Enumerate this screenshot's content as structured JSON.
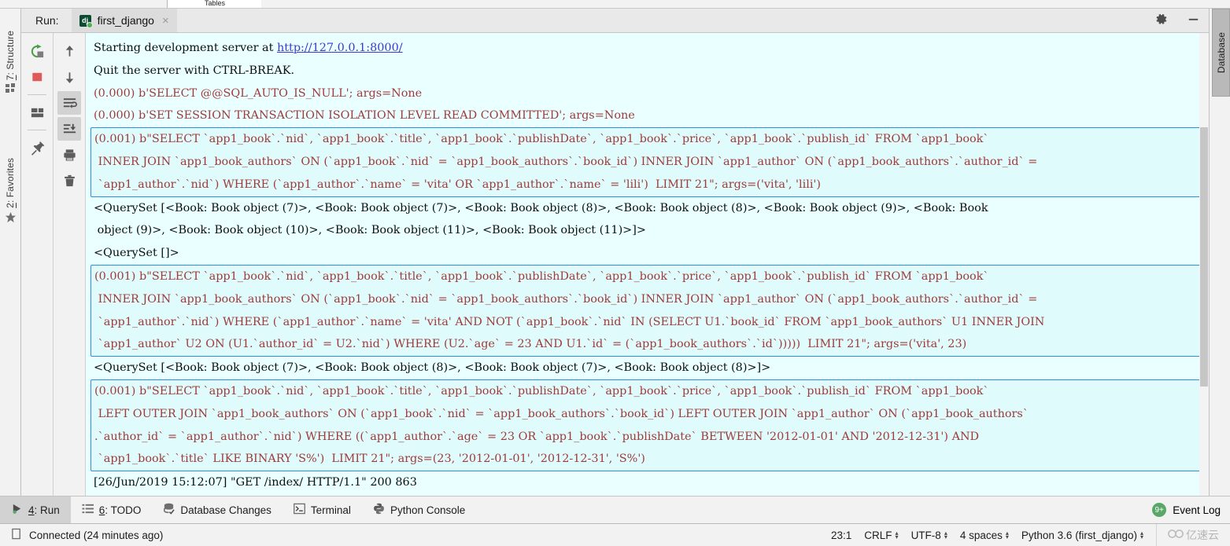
{
  "window": {
    "top_tab_stub_label": "Tables"
  },
  "run_panel": {
    "title": "Run:",
    "tab": {
      "icon": "django-icon",
      "label": "first_django",
      "close_label": "×"
    },
    "header_actions": [
      {
        "name": "settings-gear-icon",
        "label": ""
      },
      {
        "name": "minimize-icon",
        "label": ""
      }
    ],
    "toolbar_left": [
      {
        "name": "rerun-icon",
        "label": "Rerun"
      },
      {
        "name": "stop-icon",
        "label": "Stop"
      },
      {
        "name": "layout-icon",
        "label": "Layout"
      },
      {
        "name": "pin-icon",
        "label": "Pin Tab"
      }
    ],
    "toolbar_second": [
      {
        "name": "up-arrow-icon",
        "label": "Up the stack trace"
      },
      {
        "name": "down-arrow-icon",
        "label": "Down the stack trace"
      },
      {
        "name": "soft-wrap-icon",
        "label": "Use Soft Wraps"
      },
      {
        "name": "scroll-to-end-icon",
        "label": "Scroll to the end"
      },
      {
        "name": "print-icon",
        "label": "Print"
      },
      {
        "name": "trash-icon",
        "label": "Clear All"
      }
    ]
  },
  "rail_left": [
    {
      "name": "sidebar-item-structure",
      "num": "7",
      "label": ": Structure",
      "icon": "structure-icon"
    },
    {
      "name": "sidebar-item-favorites",
      "num": "2",
      "label": ": Favorites",
      "icon": "star-icon"
    }
  ],
  "rail_right": [
    {
      "name": "sidebar-item-database",
      "label": "Database",
      "icon": "database-icon"
    }
  ],
  "console": {
    "lines": [
      {
        "type": "plain",
        "segments": [
          {
            "text": "Starting development server at ",
            "style": "black"
          },
          {
            "text": "http://127.0.0.1:8000/",
            "style": "link"
          }
        ]
      },
      {
        "type": "plain",
        "segments": [
          {
            "text": "Quit the server with CTRL-BREAK.",
            "style": "black"
          }
        ]
      },
      {
        "type": "plain",
        "segments": [
          {
            "text": "(0.000) b'SELECT @@SQL_AUTO_IS_NULL'; args=None",
            "style": "sql"
          }
        ]
      },
      {
        "type": "plain",
        "segments": [
          {
            "text": "(0.000) b'SET SESSION TRANSACTION ISOLATION LEVEL READ COMMITTED'; args=None",
            "style": "sql"
          }
        ]
      },
      {
        "type": "sqlbox",
        "rows": [
          "(0.001) b\"SELECT `app1_book`.`nid`, `app1_book`.`title`, `app1_book`.`publishDate`, `app1_book`.`price`, `app1_book`.`publish_id` FROM `app1_book`",
          " INNER JOIN `app1_book_authors` ON (`app1_book`.`nid` = `app1_book_authors`.`book_id`) INNER JOIN `app1_author` ON (`app1_book_authors`.`author_id` =",
          " `app1_author`.`nid`) WHERE (`app1_author`.`name` = 'vita' OR `app1_author`.`name` = 'lili')  LIMIT 21\"; args=('vita', 'lili')"
        ]
      },
      {
        "type": "plain",
        "segments": [
          {
            "text": "<QuerySet [<Book: Book object (7)>, <Book: Book object (7)>, <Book: Book object (8)>, <Book: Book object (8)>, <Book: Book object (9)>, <Book: Book",
            "style": "black"
          }
        ]
      },
      {
        "type": "plain",
        "segments": [
          {
            "text": " object (9)>, <Book: Book object (10)>, <Book: Book object (11)>, <Book: Book object (11)>]>",
            "style": "black"
          }
        ]
      },
      {
        "type": "plain",
        "segments": [
          {
            "text": "<QuerySet []>",
            "style": "black"
          }
        ]
      },
      {
        "type": "sqlbox",
        "rows": [
          "(0.001) b\"SELECT `app1_book`.`nid`, `app1_book`.`title`, `app1_book`.`publishDate`, `app1_book`.`price`, `app1_book`.`publish_id` FROM `app1_book`",
          " INNER JOIN `app1_book_authors` ON (`app1_book`.`nid` = `app1_book_authors`.`book_id`) INNER JOIN `app1_author` ON (`app1_book_authors`.`author_id` =",
          " `app1_author`.`nid`) WHERE (`app1_author`.`name` = 'vita' AND NOT (`app1_book`.`nid` IN (SELECT U1.`book_id` FROM `app1_book_authors` U1 INNER JOIN",
          " `app1_author` U2 ON (U1.`author_id` = U2.`nid`) WHERE (U2.`age` = 23 AND U1.`id` = (`app1_book_authors`.`id`)))))  LIMIT 21\"; args=('vita', 23)"
        ]
      },
      {
        "type": "plain",
        "segments": [
          {
            "text": "<QuerySet [<Book: Book object (7)>, <Book: Book object (8)>, <Book: Book object (7)>, <Book: Book object (8)>]>",
            "style": "black"
          }
        ]
      },
      {
        "type": "sqlbox",
        "rows": [
          "(0.001) b\"SELECT `app1_book`.`nid`, `app1_book`.`title`, `app1_book`.`publishDate`, `app1_book`.`price`, `app1_book`.`publish_id` FROM `app1_book`",
          " LEFT OUTER JOIN `app1_book_authors` ON (`app1_book`.`nid` = `app1_book_authors`.`book_id`) LEFT OUTER JOIN `app1_author` ON (`app1_book_authors`",
          ".`author_id` = `app1_author`.`nid`) WHERE ((`app1_author`.`age` = 23 OR `app1_book`.`publishDate` BETWEEN '2012-01-01' AND '2012-12-31') AND",
          " `app1_book`.`title` LIKE BINARY 'S%')  LIMIT 21\"; args=(23, '2012-01-01', '2012-12-31', 'S%')"
        ]
      },
      {
        "type": "plain",
        "segments": [
          {
            "text": "[26/Jun/2019 15:12:07] \"GET /index/ HTTP/1.1\" 200 863",
            "style": "black"
          }
        ]
      }
    ]
  },
  "bottom_bar": {
    "items": [
      {
        "name": "tool-tab-run",
        "num": "4",
        "label": ": Run",
        "icon": "run-arrow-icon",
        "selected": true
      },
      {
        "name": "tool-tab-todo",
        "num": "6",
        "label": ": TODO",
        "icon": "todo-list-icon",
        "selected": false
      },
      {
        "name": "tool-tab-database-changes",
        "num": "",
        "label": "Database Changes",
        "icon": "database-changes-icon",
        "selected": false
      },
      {
        "name": "tool-tab-terminal",
        "num": "",
        "label": "Terminal",
        "icon": "terminal-icon",
        "selected": false
      },
      {
        "name": "tool-tab-python-console",
        "num": "",
        "label": "Python Console",
        "icon": "python-icon",
        "selected": false
      }
    ],
    "event_log": {
      "label": "Event Log",
      "badge": "9+"
    }
  },
  "status_bar": {
    "connection": "Connected (24 minutes ago)",
    "caret_position": "23:1",
    "line_separator": "CRLF",
    "encoding": "UTF-8",
    "indent": "4 spaces",
    "interpreter": "Python 3.6 (first_django)",
    "watermark": "亿速云"
  },
  "colors": {
    "console_bg": "#eaffff",
    "sql_text": "#9e3b3b",
    "sql_box_border": "#2d8fe0",
    "link": "#3a3ad0",
    "accent_green": "#59a869"
  }
}
